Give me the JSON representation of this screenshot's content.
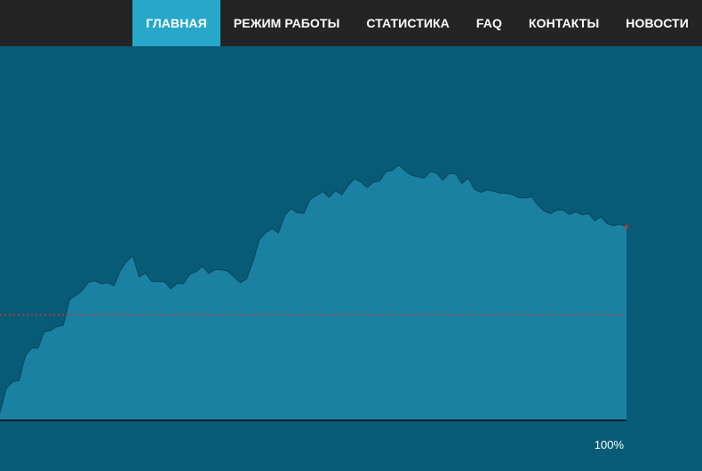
{
  "nav": {
    "items": [
      {
        "label": "ГЛАВНАЯ",
        "active": true
      },
      {
        "label": "РЕЖИМ РАБОТЫ",
        "active": false
      },
      {
        "label": "СТАТИСТИКА",
        "active": false
      },
      {
        "label": "FAQ",
        "active": false
      },
      {
        "label": "КОНТАКТЫ",
        "active": false
      },
      {
        "label": "НОВОСТИ",
        "active": false
      }
    ]
  },
  "colors": {
    "background": "#075b76",
    "area_fill": "#1a81a2",
    "area_stroke": "#0a4258",
    "active_tab": "#27a8cb",
    "reference_line": "#c0392b",
    "topbar": "#242424"
  },
  "chart_data": {
    "type": "area",
    "reference_value": 76,
    "end_label": "100%",
    "values": [
      5,
      22,
      28,
      30,
      45,
      52,
      53,
      62,
      64,
      68,
      70,
      86,
      90,
      95,
      98,
      100,
      99,
      101,
      96,
      108,
      116,
      117,
      103,
      107,
      102,
      99,
      100,
      96,
      97,
      98,
      106,
      109,
      110,
      106,
      110,
      107,
      107,
      104,
      101,
      101,
      115,
      132,
      134,
      138,
      136,
      150,
      152,
      150,
      151,
      158,
      162,
      166,
      163,
      165,
      163,
      171,
      173,
      172,
      169,
      174,
      172,
      180,
      182,
      183,
      180,
      178,
      178,
      174,
      180,
      180,
      172,
      178,
      179,
      173,
      174,
      167,
      166,
      165,
      165,
      165,
      166,
      162,
      161,
      162,
      160,
      155,
      152,
      151,
      151,
      152,
      150,
      149,
      148,
      150,
      146,
      146,
      142,
      142,
      140,
      140
    ]
  }
}
